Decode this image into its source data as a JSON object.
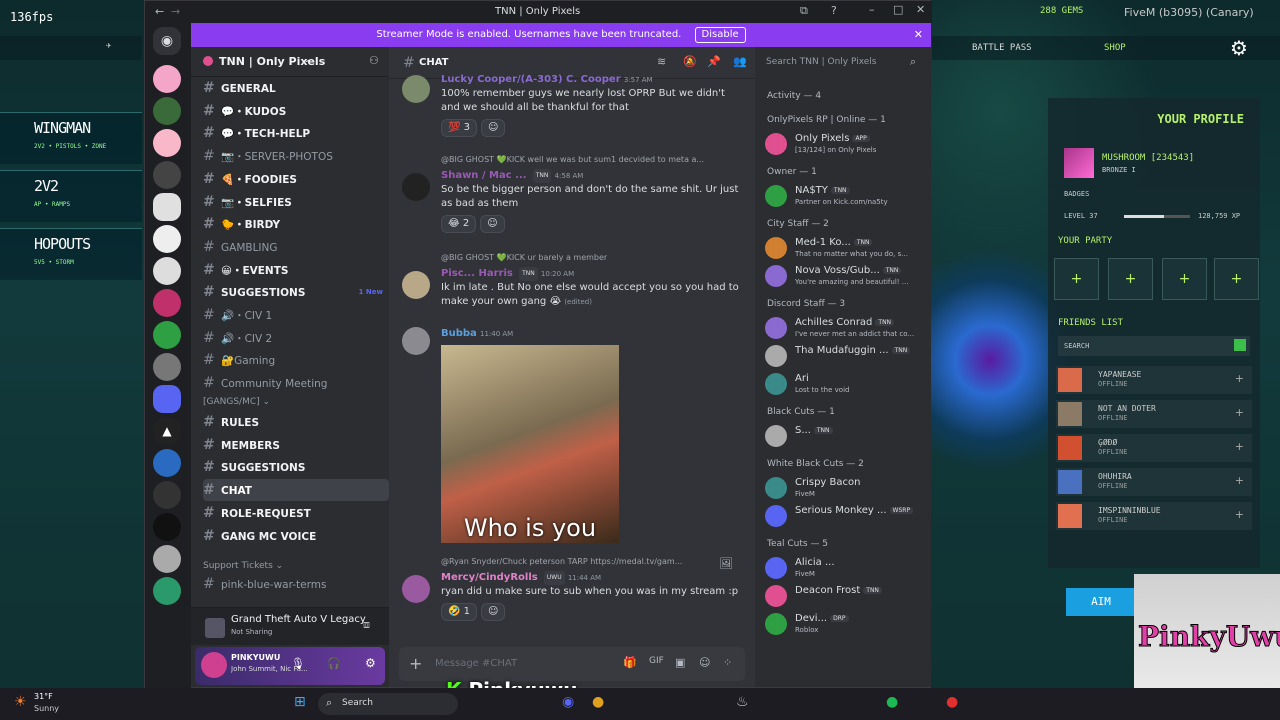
{
  "game": {
    "fps": "136fps",
    "gems": "288 GEMS",
    "fivem": "FiveM (b3095) (Canary)",
    "nav": [
      "BATTLE PASS",
      "SHOP"
    ],
    "modes": [
      {
        "title": "WINGMAN",
        "sub": "2V2 • PISTOLS • ZONE"
      },
      {
        "title": "2V2",
        "sub": "AP • RAMPS"
      },
      {
        "title": "HOPOUTS",
        "sub": "5V5 • STORM"
      }
    ],
    "profile": {
      "heading": "YOUR PROFILE",
      "name": "MUSHROOM [234543]",
      "rank": "BRONZE I",
      "badges": "BADGES",
      "level": "LEVEL 37",
      "xp": "128,759 XP",
      "party": "YOUR PARTY",
      "friends_heading": "FRIENDS LIST",
      "search": "SEARCH",
      "friends": [
        {
          "name": "YAPANEASE",
          "status": "OFFLINE"
        },
        {
          "name": "NOT AN DOTER",
          "status": "OFFLINE"
        },
        {
          "name": "ĢØĐØ",
          "status": "OFFLINE"
        },
        {
          "name": "OHUHIRA",
          "status": "OFFLINE"
        },
        {
          "name": "IMSPINNINBLUE",
          "status": "OFFLINE"
        }
      ]
    },
    "aim": "AIM",
    "logo": "PinkyUwu",
    "overlay_name": "Pinkyuwu"
  },
  "discord": {
    "window_title": "TNN | Only Pixels",
    "streamer_text": "Streamer Mode is enabled. Usernames have been truncated.",
    "disable": "Disable",
    "server_name": "TNN | Only Pixels",
    "channels": [
      {
        "label": "GENERAL",
        "icon": "#",
        "bold": true
      },
      {
        "label": "💬・KUDOS",
        "bold": true
      },
      {
        "label": "💬・TECH-HELP",
        "bold": true
      },
      {
        "label": "📷・SERVER-PHOTOS",
        "bold": false
      },
      {
        "label": "🍕・FOODIES",
        "bold": true
      },
      {
        "label": "📷・SELFIES",
        "bold": true
      },
      {
        "label": "🐤・BIRDY",
        "bold": true
      },
      {
        "label": "GAMBLING",
        "bold": false
      },
      {
        "label": "😀・EVENTS",
        "bold": true
      },
      {
        "label": "SUGGESTIONS",
        "bold": true,
        "badge": "1 New"
      },
      {
        "label": "🔊・CIV 1",
        "bold": false
      },
      {
        "label": "🔊・CIV 2",
        "bold": false
      },
      {
        "label": "🔐Gaming",
        "bold": false
      },
      {
        "label": "Community Meeting",
        "bold": false
      }
    ],
    "cat_gangs": "[GANGS/MC]",
    "gang_channels": [
      "RULES",
      "MEMBERS",
      "SUGGESTIONS",
      "CHAT",
      "ROLE-REQUEST",
      "GANG MC VOICE"
    ],
    "cat_support": "Support Tickets",
    "support_channels": [
      "pink-blue-war-terms"
    ],
    "activity": {
      "title": "Grand Theft Auto V Legacy",
      "sub": "Not Sharing"
    },
    "user": {
      "name": "PINKYUWU",
      "status": "John Summit, Nic Fa..."
    },
    "channel": "CHAT",
    "search": "Search TNN | Only Pixels",
    "input_placeholder": "Message #CHAT",
    "messages": [
      {
        "author": "Lucky Cooper/(A-303) C. Cooper",
        "time": "3:57 AM",
        "text": "100% remember guys we nearly lost OPRP But we didn't and we should all be thankful for that",
        "reaction": "💯 3"
      },
      {
        "reply": "@BIG GHOST 💚KICK well we was but sum1 decvided to meta a...",
        "author": "Shawn / Mac ...",
        "tag": "TNN",
        "time": "4:58 AM",
        "text": "So be the bigger person and don't do the same shit. Ur just as bad as them",
        "reaction": "😂 2"
      },
      {
        "reply": "@BIG GHOST 💚KICK ur barely a member",
        "author": "Pisc... Harris",
        "tag": "TNN",
        "time": "10:20 AM",
        "text": "Ik im late . But No one else would accept you so you had to make your own gang 😭",
        "edited": "(edited)"
      },
      {
        "author": "Bubba",
        "time": "11:40 AM",
        "caption": "Who is you"
      },
      {
        "reply": "@Ryan Snyder/Chuck peterson  TARP  https://medal.tv/gam...",
        "author": "Mercy/CindyRolls",
        "tag": "UWU",
        "time": "11:44 AM",
        "text": "ryan did u make sure to sub when you was in my stream :p",
        "reaction": "🤣 1"
      }
    ],
    "members_groups": [
      {
        "header": "Activity — 4"
      },
      {
        "header": "OnlyPixels RP | Online — 1",
        "members": [
          {
            "name": "Only Pixels",
            "tag": "APP",
            "status": "[13/124] on Only Pixels"
          }
        ]
      },
      {
        "header": "Owner — 1",
        "members": [
          {
            "name": "NA$TY",
            "tag": "TNN",
            "status": "Partner on Kick.com/na5ty"
          }
        ]
      },
      {
        "header": "City Staff — 2",
        "members": [
          {
            "name": "Med-1 Ko...",
            "tag": "TNN",
            "status": "That no matter what you do, s..."
          },
          {
            "name": "Nova Voss/Gub...",
            "tag": "TNN",
            "status": "You're amazing and beautiful! ..."
          }
        ]
      },
      {
        "header": "Discord Staff — 3",
        "members": [
          {
            "name": "Achilles Conrad",
            "tag": "TNN",
            "status": "I've never met an addict that co..."
          },
          {
            "name": "Tha Mudafuggin ...",
            "tag": "TNN",
            "status": ""
          },
          {
            "name": "Ari",
            "status": "Lost to the void"
          }
        ]
      },
      {
        "header": "Black Cuts — 1",
        "members": [
          {
            "name": "S...",
            "tag": "TNN",
            "status": ""
          }
        ]
      },
      {
        "header": "White Black Cuts — 2",
        "members": [
          {
            "name": "Crispy Bacon",
            "status": "FiveM"
          },
          {
            "name": "Serious Monkey ...",
            "tag": "WSRP",
            "status": ""
          }
        ]
      },
      {
        "header": "Teal Cuts — 5",
        "members": [
          {
            "name": "Alicia ...",
            "status": "FiveM"
          },
          {
            "name": "Deacon Frost",
            "tag": "TNN",
            "status": ""
          },
          {
            "name": "Devi...",
            "tag": "DRP",
            "status": "Roblox"
          }
        ]
      }
    ]
  },
  "taskbar": {
    "temp": "31°F",
    "weather": "Sunny",
    "search": "Search"
  }
}
